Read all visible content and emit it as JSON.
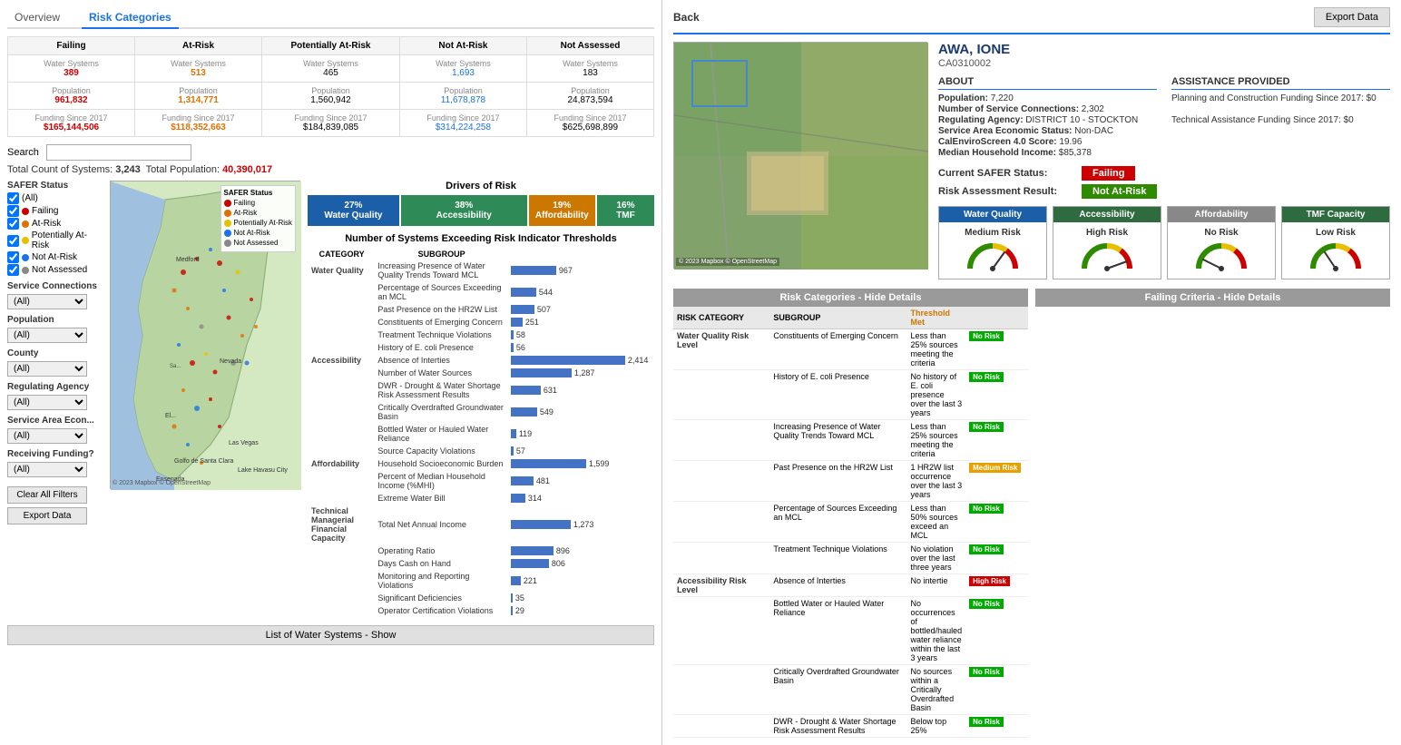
{
  "left": {
    "tabs": [
      {
        "label": "Overview",
        "active": false
      },
      {
        "label": "Risk Categories",
        "active": true
      }
    ],
    "status_table": {
      "headers": [
        "Failing",
        "At-Risk",
        "Potentially At-Risk",
        "Not At-Risk",
        "Not Assessed"
      ],
      "rows": [
        {
          "label": "Water Systems",
          "values": [
            "389",
            "513",
            "465",
            "1,693",
            "183"
          ],
          "colors": [
            "red",
            "orange",
            "black",
            "blue",
            "black"
          ]
        },
        {
          "label": "Population",
          "values": [
            "961,832",
            "1,314,771",
            "1,560,942",
            "11,678,878",
            "24,873,594"
          ],
          "colors": [
            "red",
            "orange",
            "black",
            "blue",
            "black"
          ]
        },
        {
          "label": "Funding Since 2017",
          "values": [
            "$165,144,506",
            "$118,352,663",
            "$184,839,085",
            "$314,224,258",
            "$625,698,899"
          ],
          "colors": [
            "red",
            "orange",
            "black",
            "blue",
            "black"
          ]
        }
      ]
    },
    "search_label": "Search",
    "search_placeholder": "",
    "total_systems": "3,243",
    "total_population": "40,390,017",
    "total_text": "Total Count of Systems: 3,243  Total Population: 40,390,017",
    "safer_status": {
      "title": "SAFER Status",
      "items": [
        "(All)",
        "Failing",
        "At-Risk",
        "Potentially At-Risk",
        "Not At-Risk",
        "Not Assessed"
      ]
    },
    "service_connections_label": "Service Connections",
    "population_label": "Population",
    "county_label": "County",
    "regulating_agency_label": "Regulating Agency",
    "service_area_econ_label": "Service Area Econ...",
    "receiving_funding_label": "Receiving Funding?",
    "clear_all_filters": "Clear All Filters",
    "export_data": "Export Data",
    "map_legend": {
      "title": "SAFER Status",
      "items": [
        {
          "label": "Failing",
          "color": "#cc0000"
        },
        {
          "label": "At-Risk",
          "color": "#e07000"
        },
        {
          "label": "Potentially At-Risk",
          "color": "#e8c000"
        },
        {
          "label": "Not At-Risk",
          "color": "#1a73e8"
        },
        {
          "label": "Not Assessed",
          "color": "#888888"
        }
      ]
    },
    "map_credit": "© 2023 Mapbox © OpenStreetMap",
    "drivers": {
      "title": "Drivers of Risk",
      "items": [
        {
          "label": "27%\nWater Quality",
          "pct": 27,
          "color": "#1a5fa8"
        },
        {
          "label": "38%\nAccessibility",
          "pct": 38,
          "color": "#2e8b57"
        },
        {
          "label": "19%\nAffordability",
          "pct": 19,
          "color": "#cc7700"
        },
        {
          "label": "16%\nTMF",
          "pct": 16,
          "color": "#2e6b3e"
        }
      ]
    },
    "chart_title": "Number of Systems Exceeding Risk Indicator Thresholds",
    "chart_headers": [
      "CATEGORY",
      "SUBGROUP",
      ""
    ],
    "chart_rows": [
      {
        "category": "Water Quality",
        "subgroup": "Increasing Presence of Water Quality Trends Toward MCL",
        "value": 967,
        "max": 2500
      },
      {
        "category": "",
        "subgroup": "Percentage of Sources Exceeding an MCL",
        "value": 544,
        "max": 2500
      },
      {
        "category": "",
        "subgroup": "Past Presence on the HR2W List",
        "value": 507,
        "max": 2500
      },
      {
        "category": "",
        "subgroup": "Constituents of Emerging Concern",
        "value": 251,
        "max": 2500
      },
      {
        "category": "",
        "subgroup": "Treatment Technique Violations",
        "value": 58,
        "max": 2500
      },
      {
        "category": "",
        "subgroup": "History of E. coli Presence",
        "value": 56,
        "max": 2500
      },
      {
        "category": "Accessibility",
        "subgroup": "Absence of Interties",
        "value": 2414,
        "max": 2500
      },
      {
        "category": "",
        "subgroup": "Number of Water Sources",
        "value": 1287,
        "max": 2500
      },
      {
        "category": "",
        "subgroup": "DWR - Drought & Water Shortage Risk Assessment Results",
        "value": 631,
        "max": 2500
      },
      {
        "category": "",
        "subgroup": "Critically Overdrafted Groundwater Basin",
        "value": 549,
        "max": 2500
      },
      {
        "category": "",
        "subgroup": "Bottled Water or Hauled Water Reliance",
        "value": 119,
        "max": 2500
      },
      {
        "category": "",
        "subgroup": "Source Capacity Violations",
        "value": 57,
        "max": 2500
      },
      {
        "category": "Affordability",
        "subgroup": "Household Socioeconomic Burden",
        "value": 1599,
        "max": 2500
      },
      {
        "category": "",
        "subgroup": "Percent of Median Household Income (%MHI)",
        "value": 481,
        "max": 2500
      },
      {
        "category": "",
        "subgroup": "Extreme Water Bill",
        "value": 314,
        "max": 2500
      },
      {
        "category": "Technical\nManagerial\nFinancial\nCapacity",
        "subgroup": "Total Net Annual Income",
        "value": 1273,
        "max": 2500
      },
      {
        "category": "",
        "subgroup": "Operating Ratio",
        "value": 896,
        "max": 2500
      },
      {
        "category": "",
        "subgroup": "Days Cash on Hand",
        "value": 806,
        "max": 2500
      },
      {
        "category": "",
        "subgroup": "Monitoring and Reporting Violations",
        "value": 221,
        "max": 2500
      },
      {
        "category": "",
        "subgroup": "Significant Deficiencies",
        "value": 35,
        "max": 2500
      },
      {
        "category": "",
        "subgroup": "Operator Certification Violations",
        "value": 29,
        "max": 2500
      }
    ],
    "list_show": "List of Water Systems - Show"
  },
  "right": {
    "back_label": "Back",
    "export_label": "Export Data",
    "system_name": "AWA, IONE",
    "system_id": "CA0310002",
    "about_title": "ABOUT",
    "about_fields": [
      {
        "label": "Population:",
        "value": "7,220"
      },
      {
        "label": "Number of Service Connections:",
        "value": "2,302"
      },
      {
        "label": "Regulating Agency:",
        "value": "DISTRICT 10 - STOCKTON"
      },
      {
        "label": "Service Area Economic Status:",
        "value": "Non-DAC"
      },
      {
        "label": "CalEnviroScreen 4.0 Score:",
        "value": "19.96"
      },
      {
        "label": "Median Household Income:",
        "value": "$85,378"
      }
    ],
    "assistance_title": "ASSISTANCE PROVIDED",
    "assistance_fields": [
      {
        "label": "Planning and Construction Funding Since 2017:",
        "value": "$0"
      },
      {
        "label": "Technical Assistance Funding Since 2017:",
        "value": "$0"
      }
    ],
    "current_safer_label": "Current SAFER Status:",
    "current_safer_value": "Failing",
    "risk_assessment_label": "Risk Assessment Result:",
    "risk_assessment_value": "Not At-Risk",
    "risk_cards": [
      {
        "title": "Water Quality",
        "level": "Medium Risk",
        "color": "#1a5fa8",
        "gauge_level": "medium"
      },
      {
        "title": "Accessibility",
        "level": "High Risk",
        "color": "#2e6b3e",
        "gauge_level": "high"
      },
      {
        "title": "Affordability",
        "level": "No Risk",
        "color": "#888888",
        "gauge_level": "none"
      },
      {
        "title": "TMF Capacity",
        "level": "Low Risk",
        "color": "#2e6b3e",
        "gauge_level": "low"
      }
    ],
    "risk_categories_header": "Risk Categories - Hide Details",
    "failing_criteria_header": "Failing Criteria - Hide Details",
    "risk_table_headers": [
      "RISK CATEGORY",
      "SUBGROUP",
      "Threshold Met",
      ""
    ],
    "risk_rows": [
      {
        "category": "Water Quality Risk Level",
        "subgroup": "Constituents of Emerging Concern",
        "threshold": "Less than 25% sources meeting the criteria",
        "risk": "No Risk",
        "risk_class": "no-risk"
      },
      {
        "category": "",
        "subgroup": "History of E. coli Presence",
        "threshold": "No history of E. coli presence over the last 3 years",
        "risk": "No Risk",
        "risk_class": "no-risk"
      },
      {
        "category": "",
        "subgroup": "Increasing Presence of Water Quality Trends Toward MCL",
        "threshold": "Less than 25% sources meeting the criteria",
        "risk": "No Risk",
        "risk_class": "no-risk"
      },
      {
        "category": "",
        "subgroup": "Past Presence on the HR2W List",
        "threshold": "1 HR2W list occurrence over the last 3 years",
        "risk": "Medium Risk",
        "risk_class": "medium-risk"
      },
      {
        "category": "",
        "subgroup": "Percentage of Sources Exceeding an MCL",
        "threshold": "Less than 50% sources exceed an MCL",
        "risk": "No Risk",
        "risk_class": "no-risk"
      },
      {
        "category": "",
        "subgroup": "Treatment Technique Violations",
        "threshold": "No violation over the last three years",
        "risk": "No Risk",
        "risk_class": "no-risk"
      },
      {
        "category": "Accessibility Risk Level",
        "subgroup": "Absence of Interties",
        "threshold": "No intertie",
        "risk": "High Risk",
        "risk_class": "high-risk"
      },
      {
        "category": "",
        "subgroup": "Bottled Water or Hauled Water Reliance",
        "threshold": "No occurrences of bottled/hauled water reliance within the last 3 years",
        "risk": "No Risk",
        "risk_class": "no-risk"
      },
      {
        "category": "",
        "subgroup": "Critically Overdrafted Groundwater Basin",
        "threshold": "No sources within a Critically Overdrafted Basin",
        "risk": "No Risk",
        "risk_class": "no-risk"
      },
      {
        "category": "",
        "subgroup": "DWR - Drought & Water Shortage Risk Assessment Results",
        "threshold": "Below top 25%",
        "risk": "No Risk",
        "risk_class": "no-risk"
      }
    ],
    "map_credit": "© 2023 Mapbox © OpenStreetMap"
  }
}
